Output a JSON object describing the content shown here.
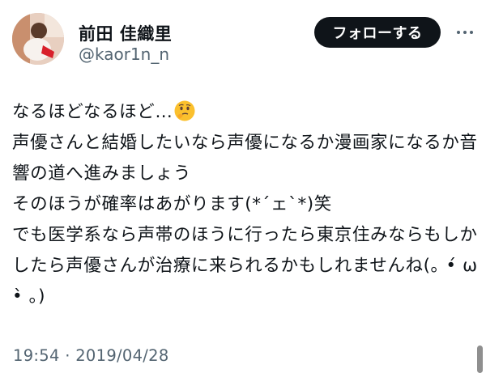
{
  "user": {
    "display_name": "前田 佳織里",
    "handle": "@kaor1n_n"
  },
  "follow_button": {
    "label": "フォローする"
  },
  "more_icon": "more-horizontal-icon",
  "tweet": {
    "line1": "なるほどなるほど…",
    "line1_emoji": "thinking-face-emoji",
    "rest": "声優さんと結婚したいなら声優になるか漫画家になるか音響の道へ進みましょう\nそのほうが確率はあがります(*´ェ`*)笑\nでも医学系なら声帯のほうに行ったら東京住みならもしかしたら声優さんが治療に来られるかもしれませんね(｡ •́ ω •̀ ｡)"
  },
  "timestamp": {
    "time": "19:54",
    "separator": " · ",
    "date": "2019/04/28"
  },
  "colors": {
    "text": "#0f1419",
    "secondary": "#536471",
    "button_bg": "#0f1419",
    "button_text": "#ffffff"
  }
}
